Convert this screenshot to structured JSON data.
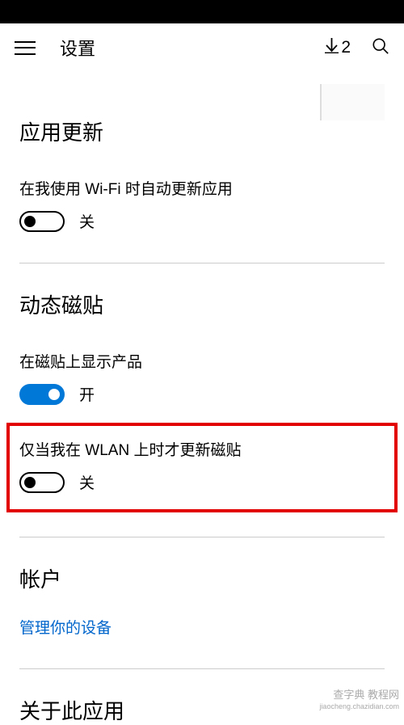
{
  "header": {
    "title": "设置",
    "download_count": "2"
  },
  "sections": {
    "app_update": {
      "title": "应用更新",
      "wifi_auto_update": {
        "label": "在我使用 Wi-Fi 时自动更新应用",
        "state": "关"
      }
    },
    "live_tile": {
      "title": "动态磁贴",
      "show_products": {
        "label": "在磁贴上显示产品",
        "state": "开"
      },
      "wlan_only": {
        "label": "仅当我在 WLAN 上时才更新磁贴",
        "state": "关"
      }
    },
    "account": {
      "title": "帐户",
      "manage_devices": "管理你的设备"
    },
    "about": {
      "title": "关于此应用"
    }
  },
  "watermark": {
    "line1": "查字典  教程网",
    "line2": "jiaocheng.chazidian.com"
  }
}
